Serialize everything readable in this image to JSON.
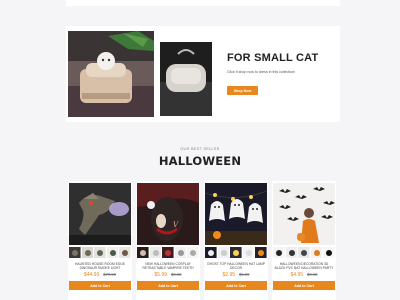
{
  "colors": {
    "accent": "#e8871e",
    "background": "#f5f4f6",
    "card": "#ffffff"
  },
  "promo": {
    "title": "FOR SMALL CAT",
    "subtitle": "Click it shop now to dress in this collection!",
    "button_label": "Shop Now"
  },
  "section": {
    "eyebrow": "OUR BEST SELLER",
    "title": "HALLOWEEN"
  },
  "products": [
    {
      "name": "HAUNTED HOUSE ROOM EDGE DINOSAUR SMOKE LIGHT",
      "price": "$44.99",
      "old_price": "$79.99",
      "button_label": "Add to Cart"
    },
    {
      "name": "NEW HALLOWEEN COSPLAY RETRACTABLE VAMPIRE TEETH",
      "price": "$5.99",
      "old_price": "$9.99",
      "button_label": "Add to Cart"
    },
    {
      "name": "GHOST TOP HALLOWEEN HAT LAMP DECOR",
      "price": "$2.95",
      "old_price": "$5.99",
      "button_label": "Add to Cart"
    },
    {
      "name": "HALLOWEEN DECORATION 3D BLACK PVC BAT HALLOWEEN PARTY",
      "price": "$4.95",
      "old_price": "$9.99",
      "button_label": "Add to Cart"
    }
  ]
}
